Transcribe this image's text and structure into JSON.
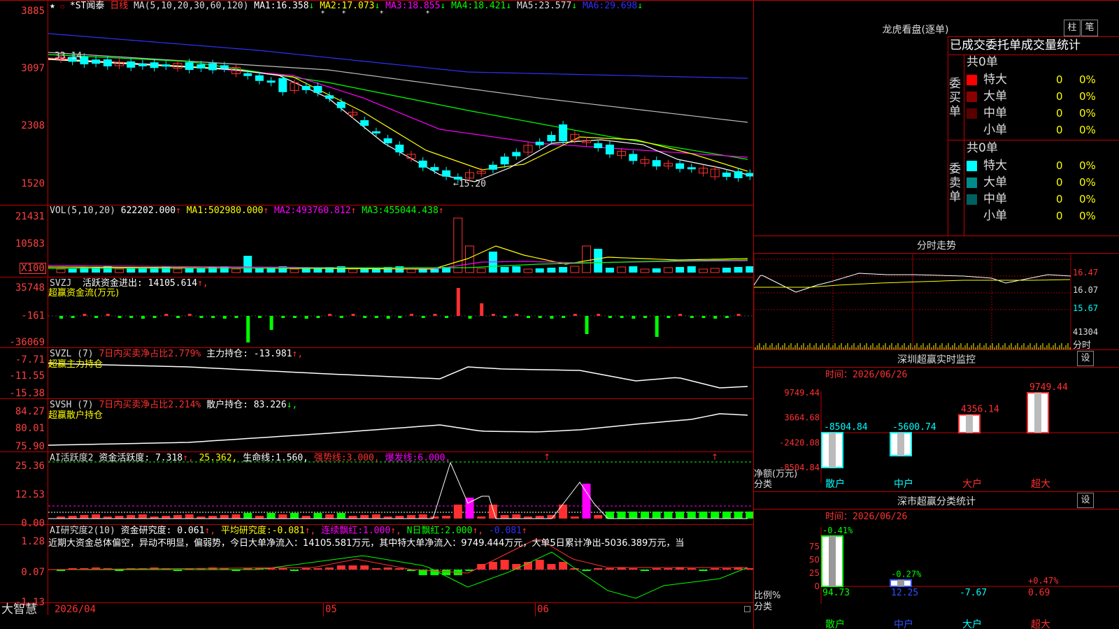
{
  "app_brand": "大智慧",
  "date_label": "2026/04",
  "month_labels": [
    "05",
    "06"
  ],
  "colors": {
    "up": "#ff3030",
    "down": "#00ffff",
    "ma1": "#ffffff",
    "ma2": "#ffff00",
    "ma3": "#ff00ff",
    "ma4": "#00ff00",
    "ma5": "#c0c0c0",
    "ma6": "#3030ff",
    "grid": "#c00000"
  },
  "price_panel": {
    "star": "★",
    "dot": "○",
    "name": "*ST闻泰",
    "period": "日线",
    "ma_params": "MA(5,10,20,30,60,120)",
    "items": [
      {
        "label": "MA1:",
        "value": "16.358",
        "arrow": "↓"
      },
      {
        "label": "MA2:",
        "value": "17.073",
        "arrow": "↓"
      },
      {
        "label": "MA3:",
        "value": "18.855",
        "arrow": "↓"
      },
      {
        "label": "MA4:",
        "value": "18.421",
        "arrow": "↓"
      },
      {
        "label": "MA5:",
        "value": "23.577",
        "arrow": "↓"
      },
      {
        "label": "MA6:",
        "value": "29.698",
        "arrow": "↓"
      }
    ],
    "y_ticks": [
      "3885",
      "3097",
      "2308",
      "1520"
    ],
    "hi_label": "33.14",
    "lo_label": "←15.20"
  },
  "vol_panel": {
    "title": "VOL(5,10,20)",
    "value": "622202.000",
    "arrow": "↑",
    "items": [
      {
        "label": "MA1:",
        "value": "502980.000",
        "arrow": "↑"
      },
      {
        "label": "MA2:",
        "value": "493760.812",
        "arrow": "↑"
      },
      {
        "label": "MA3:",
        "value": "455044.438",
        "arrow": "↑"
      }
    ],
    "y_ticks": [
      "21431",
      "10583",
      "X100"
    ]
  },
  "svzj_panel": {
    "title": "SVZJ",
    "label": "活跃资金进出:",
    "value": "14105.614",
    "arrow": "↑,",
    "sub": "超赢资金流(万元)",
    "y_ticks": [
      "35748",
      "-161",
      "-36069"
    ]
  },
  "svzl_panel": {
    "title": "SVZL (7)",
    "desc": "7日内买卖净占比2.779%",
    "label": "主力持仓:",
    "value": "-13.981",
    "arrow": "↑,",
    "sub": "超赢主力持仓",
    "y_ticks": [
      "-7.71",
      "-11.55",
      "-15.38"
    ]
  },
  "svsh_panel": {
    "title": "SVSH (7)",
    "desc": "7日内买卖净占比2.214%",
    "label": "散户持仓:",
    "value": "83.226",
    "arrow": "↓,",
    "sub": "超赢散户持仓",
    "y_ticks": [
      "84.27",
      "80.01",
      "75.90"
    ]
  },
  "ai_active_panel": {
    "title": "AI活跃度2",
    "label": "资金活跃度:",
    "value": "7.318",
    "arrow": "↑,",
    "v2": "25.362,",
    "l3": "生命线:",
    "v3": "1.560,",
    "l4": "强势线:",
    "v4": "3.000,",
    "l5": "爆发线:",
    "v5": "6.000,",
    "y_ticks": [
      "25.36",
      "12.53",
      "0.00"
    ]
  },
  "ai_research_panel": {
    "title": "AI研究度2(10)",
    "label": "资金研究度:",
    "value": "0.061",
    "arrow": "↑,",
    "l2": "平均研究度:",
    "v2": "-0.081",
    "a2": "↑,",
    "l3": "连续飘红:",
    "v3": "1.000",
    "a3": "↑,",
    "l4": "N日飘红:",
    "v4": "2.000",
    "a4": "↑,",
    "v5": "-0.081",
    "a5": "↑",
    "comment": "近期大资金总体偏空，异动不明显，偏弱势，今日大单净流入：14105.581万元，其中特大单净流入：9749.444万元，大单5日累计净出-5036.389万元，当",
    "y_ticks": [
      "1.28",
      "0.07",
      "-1.13"
    ]
  },
  "dragon_panel": {
    "title": "龙虎看盘(逐单)",
    "tab1": "柱",
    "tab2": "笔",
    "subtitle": "已成交委托单成交量统计",
    "buy": {
      "side_label": "委买单",
      "count": "共0单",
      "rows": [
        {
          "name": "特大",
          "qty": "0",
          "pct": "0%",
          "color": "#ff0000"
        },
        {
          "name": "大单",
          "qty": "0",
          "pct": "0%",
          "color": "#8b0000"
        },
        {
          "name": "中单",
          "qty": "0",
          "pct": "0%",
          "color": "#5a0000"
        },
        {
          "name": "小单",
          "qty": "0",
          "pct": "0%",
          "color": "#000000"
        }
      ]
    },
    "sell": {
      "side_label": "委卖单",
      "count": "共0单",
      "rows": [
        {
          "name": "特大",
          "qty": "0",
          "pct": "0%",
          "color": "#00ffff"
        },
        {
          "name": "大单",
          "qty": "0",
          "pct": "0%",
          "color": "#008b8b"
        },
        {
          "name": "中单",
          "qty": "0",
          "pct": "0%",
          "color": "#006060"
        },
        {
          "name": "小单",
          "qty": "0",
          "pct": "0%",
          "color": "#000000"
        }
      ]
    }
  },
  "intraday_panel": {
    "title": "分时走势",
    "y_ticks": [
      "16.47",
      "16.07",
      "15.67",
      "41304",
      "分时"
    ]
  },
  "monitor_panel": {
    "title": "深圳超赢实时监控",
    "settings": "设",
    "time_label": "时间：",
    "date": "2026/06/26",
    "y_ticks": [
      "9749.44",
      "3664.68",
      "-2420.08",
      "-8504.84"
    ],
    "net_label": "净额(万元)",
    "class_label": "分类",
    "categories": [
      "散户",
      "中户",
      "大户",
      "超大"
    ],
    "values": [
      -8504.84,
      -5600.74,
      4356.14,
      9749.44
    ],
    "value_labels": [
      "-8504.84",
      "-5600.74",
      "4356.14",
      "9749.44"
    ]
  },
  "stats_panel": {
    "title": "深市超赢分类统计",
    "settings": "设",
    "time_label": "时间：",
    "date": "2026/06/26",
    "y_ticks": [
      "75",
      "50",
      "25",
      "0"
    ],
    "ratio_label": "比例%",
    "class_label": "分类",
    "categories": [
      "散户",
      "中户",
      "大户",
      "超大"
    ],
    "pct_top": [
      "-0.41%",
      "-0.27%",
      "",
      "+0.47%"
    ],
    "values": [
      94.73,
      12.25,
      -7.67,
      0.69
    ],
    "value_labels": [
      "94.73",
      "12.25",
      "-7.67",
      "0.69"
    ]
  }
}
